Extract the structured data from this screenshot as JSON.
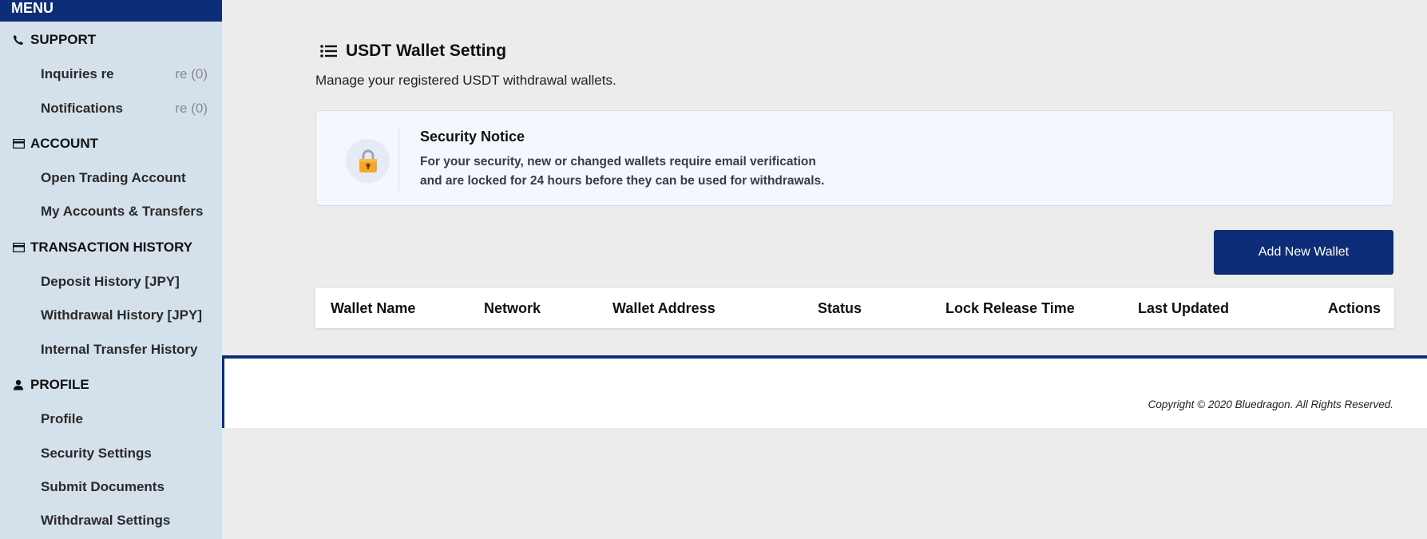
{
  "sidebar": {
    "menu_label": "MENU",
    "sections": [
      {
        "label": "SUPPORT",
        "icon": "phone-icon"
      },
      {
        "label": "ACCOUNT",
        "icon": "card-icon"
      },
      {
        "label": "TRANSACTION HISTORY",
        "icon": "card-icon"
      },
      {
        "label": "PROFILE",
        "icon": "person-icon"
      }
    ],
    "support_items": [
      {
        "label": "Inquiries re",
        "count": "re (0)"
      },
      {
        "label": "Notifications",
        "count": "re (0)"
      }
    ],
    "account_items": [
      "Open Trading Account",
      "My Accounts & Transfers"
    ],
    "history_items": [
      "Deposit History [JPY]",
      "Withdrawal History [JPY]",
      "Internal Transfer History"
    ],
    "profile_items": [
      "Profile",
      "Security Settings",
      "Submit Documents",
      "Withdrawal Settings"
    ]
  },
  "main": {
    "title": "USDT Wallet Setting",
    "subtitle": "Manage your registered USDT withdrawal wallets.",
    "notice": {
      "title": "Security Notice",
      "line1": "For your security, new or changed wallets require email verification",
      "line2": "and are locked for 24 hours before they can be used for withdrawals."
    },
    "add_button": "Add New Wallet",
    "table_headers": [
      "Wallet Name",
      "Network",
      "Wallet Address",
      "Status",
      "Lock Release Time",
      "Last Updated",
      "Actions"
    ]
  },
  "footer": {
    "copyright": "Copyright © 2020 Bluedragon. All Rights Reserved."
  },
  "colors": {
    "brand": "#0e2d78",
    "sidebar_bg": "#d4e1ea",
    "page_bg": "#ececec"
  }
}
